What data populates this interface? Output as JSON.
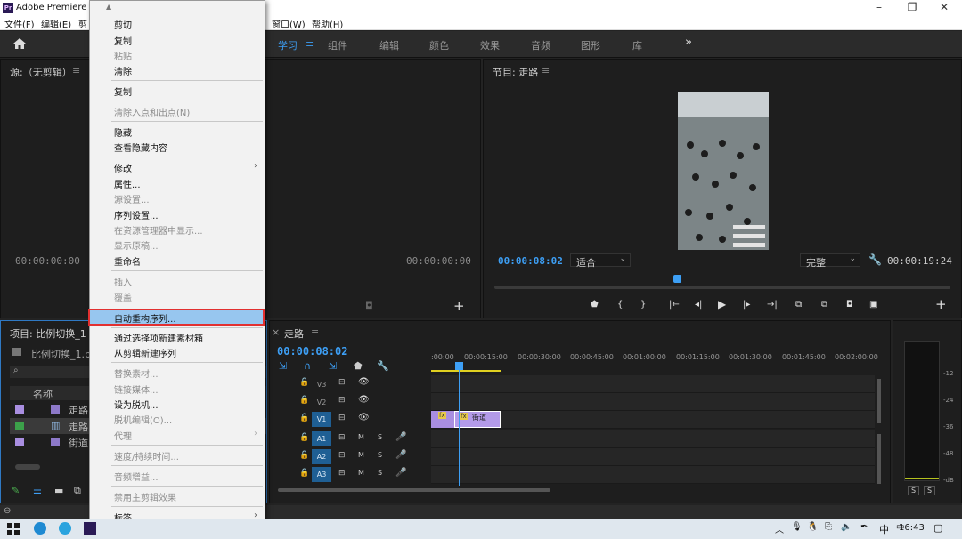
{
  "window": {
    "title": "Adobe Premiere F",
    "app_icon": "Pr",
    "controls": [
      "–",
      "❐",
      "✕"
    ]
  },
  "menubar": {
    "items": [
      "文件(F)",
      "编辑(E)",
      "剪",
      "窗口(W)",
      "帮助(H)"
    ]
  },
  "workspaces": {
    "items": [
      "学习",
      "组件",
      "编辑",
      "颜色",
      "效果",
      "音频",
      "图形",
      "库"
    ],
    "more": "»",
    "active_menu_glyph": "≡"
  },
  "source_panel": {
    "title": "源:（无剪辑）",
    "menu_glyph": "≡",
    "timecode_left": "00:00:00:00",
    "timecode_right": "00:00:00:00"
  },
  "program_panel": {
    "title": "节目: 走路",
    "menu_glyph": "≡",
    "timecode": "00:00:08:02",
    "fit": "适合",
    "quality": "完整",
    "duration": "00:00:19:24",
    "playhead_fraction": 0.4
  },
  "project_panel": {
    "title": "项目: 比例切换_1",
    "file": "比例切换_1.prp",
    "column_name": "名称",
    "items": [
      {
        "name": "走路.",
        "color": "#a98ee0"
      },
      {
        "name": "走路",
        "color": "#3ca04a"
      },
      {
        "name": "街道.",
        "color": "#a98ee0"
      }
    ]
  },
  "timeline": {
    "title": "走路",
    "menu_glyph": "≡",
    "timecode": "00:00:08:02",
    "ruler": [
      ":00:00",
      "00:00:15:00",
      "00:00:30:00",
      "00:00:45:00",
      "00:01:00:00",
      "00:01:15:00",
      "00:01:30:00",
      "00:01:45:00",
      "00:02:00:00"
    ],
    "video_tracks": [
      {
        "name": "V3"
      },
      {
        "name": "V2"
      },
      {
        "name": "V1",
        "on": true
      }
    ],
    "audio_tracks": [
      {
        "name": "A1"
      },
      {
        "name": "A2"
      },
      {
        "name": "A3"
      }
    ],
    "clip_label": "街道",
    "fx": "fx",
    "m": "M",
    "s": "S"
  },
  "meter": {
    "scale": [
      "-12",
      "-24",
      "-36",
      "-48",
      "-dB"
    ],
    "solo": "S"
  },
  "context_menu": {
    "items": [
      {
        "label": "剪切",
        "disabled": false
      },
      {
        "label": "复制",
        "disabled": false
      },
      {
        "label": "粘贴",
        "disabled": true
      },
      {
        "label": "清除",
        "disabled": false
      },
      {
        "label": "复制",
        "disabled": false
      },
      {
        "label": "清除入点和出点(N)",
        "disabled": true
      },
      {
        "label": "隐藏",
        "disabled": false
      },
      {
        "label": "查看隐藏内容",
        "disabled": false
      },
      {
        "label": "修改",
        "disabled": false,
        "submenu": true
      },
      {
        "label": "属性...",
        "disabled": false
      },
      {
        "label": "源设置...",
        "disabled": true
      },
      {
        "label": "序列设置...",
        "disabled": false
      },
      {
        "label": "在资源管理器中显示...",
        "disabled": true
      },
      {
        "label": "显示原稿...",
        "disabled": true
      },
      {
        "label": "重命名",
        "disabled": false
      },
      {
        "label": "插入",
        "disabled": true
      },
      {
        "label": "覆盖",
        "disabled": true
      },
      {
        "label": "自动重构序列...",
        "disabled": false,
        "highlighted": true
      },
      {
        "label": "通过选择项新建素材箱",
        "disabled": false
      },
      {
        "label": "从剪辑新建序列",
        "disabled": false
      },
      {
        "label": "替换素材...",
        "disabled": true
      },
      {
        "label": "链接媒体...",
        "disabled": true
      },
      {
        "label": "设为脱机...",
        "disabled": false
      },
      {
        "label": "脱机编辑(O)...",
        "disabled": true
      },
      {
        "label": "代理",
        "disabled": true,
        "submenu": true
      },
      {
        "label": "速度/持续时间...",
        "disabled": true
      },
      {
        "label": "音频增益...",
        "disabled": true
      },
      {
        "label": "禁用主剪辑效果",
        "disabled": true
      },
      {
        "label": "标签",
        "disabled": false,
        "submenu": true
      }
    ],
    "scroll_up": "▲",
    "scroll_down": "▼"
  },
  "taskbar": {
    "time": "16:43",
    "ime": "中"
  }
}
